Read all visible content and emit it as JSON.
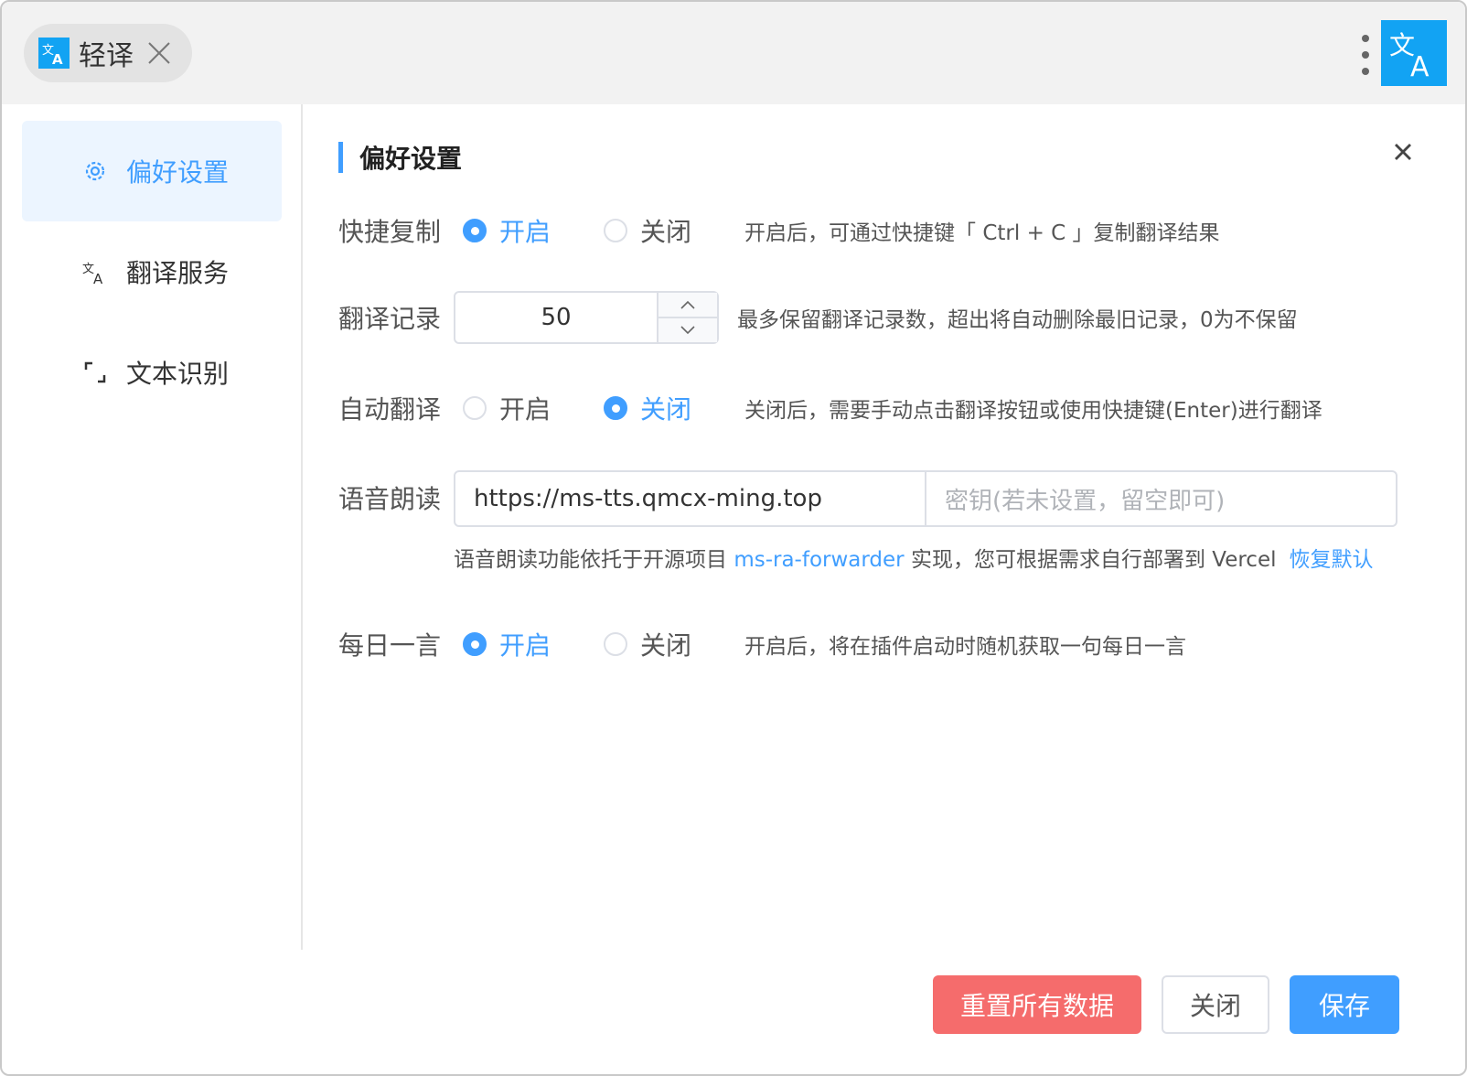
{
  "app": {
    "tab_title": "轻译",
    "logo_glyph": "文A",
    "accent": "#409eff",
    "brand": "#12a3f3"
  },
  "sidebar": {
    "items": [
      {
        "label": "偏好设置",
        "icon": "gear-icon",
        "active": true
      },
      {
        "label": "翻译服务",
        "icon": "translate-icon",
        "active": false
      },
      {
        "label": "文本识别",
        "icon": "scan-icon",
        "active": false
      }
    ]
  },
  "section": {
    "title": "偏好设置"
  },
  "settings": {
    "quick_copy": {
      "label": "快捷复制",
      "on_label": "开启",
      "off_label": "关闭",
      "selected": "on",
      "hint": "开启后，可通过快捷键「 Ctrl + C 」复制翻译结果"
    },
    "history": {
      "label": "翻译记录",
      "value": "50",
      "hint": "最多保留翻译记录数，超出将自动删除最旧记录，0为不保留"
    },
    "auto_translate": {
      "label": "自动翻译",
      "on_label": "开启",
      "off_label": "关闭",
      "selected": "off",
      "hint": "关闭后，需要手动点击翻译按钮或使用快捷键(Enter)进行翻译"
    },
    "tts": {
      "label": "语音朗读",
      "url": "https://ms-tts.qmcx-ming.top",
      "key_placeholder": "密钥(若未设置，留空即可)",
      "note_prefix": "语音朗读功能依托于开源项目 ",
      "note_link": "ms-ra-forwarder",
      "note_suffix": " 实现，您可根据需求自行部署到 Vercel",
      "restore_label": "恢复默认"
    },
    "daily_quote": {
      "label": "每日一言",
      "on_label": "开启",
      "off_label": "关闭",
      "selected": "on",
      "hint": "开启后，将在插件启动时随机获取一句每日一言"
    }
  },
  "footer": {
    "reset_label": "重置所有数据",
    "close_label": "关闭",
    "save_label": "保存"
  }
}
